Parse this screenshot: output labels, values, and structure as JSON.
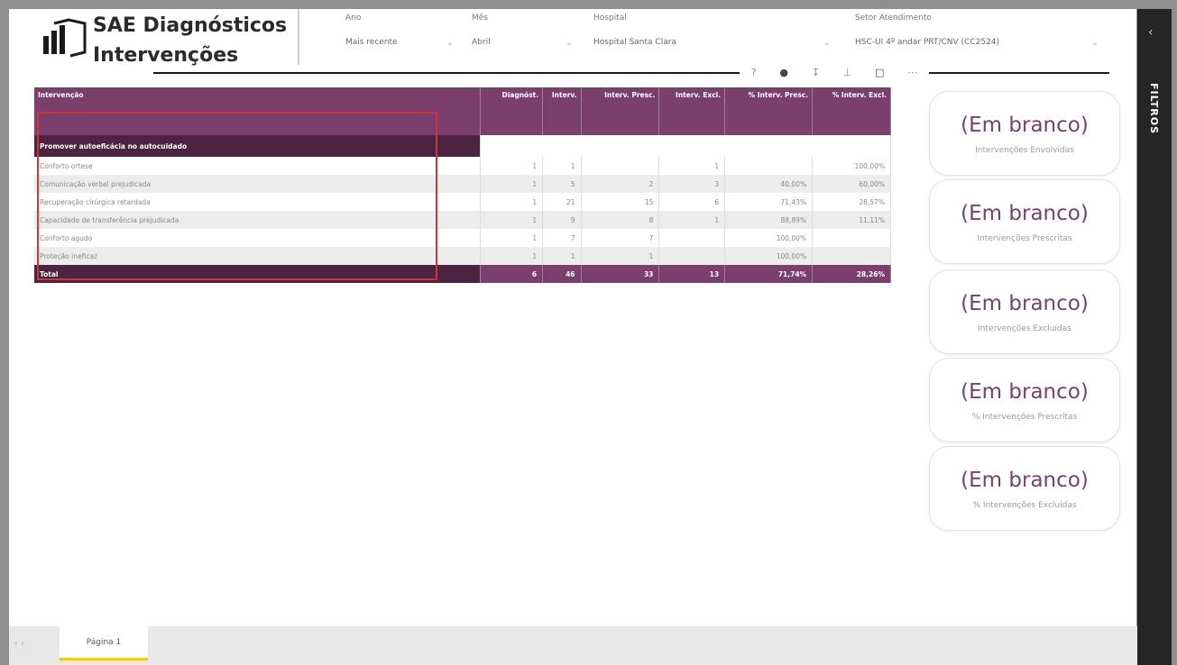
{
  "header": {
    "title_line1": "SAE Diagnósticos",
    "title_line2": "Intervenções"
  },
  "filters": [
    {
      "label": "Ano",
      "value": "Mais recente"
    },
    {
      "label": "Mês",
      "value": "Abril"
    },
    {
      "label": "Hospital",
      "value": "Hospital Santa Clara"
    },
    {
      "label": "Setor Atendimento",
      "value": "HSC-UI 4º andar PRT/CNV (CC2524)"
    }
  ],
  "table": {
    "columns": [
      "Intervenção",
      "Diagnóst.",
      "Interv.",
      "Interv. Presc.",
      "Interv. Excl.",
      "% Interv. Presc.",
      "% Interv. Excl."
    ],
    "group_label": "Promover autoeficácia no autocuidado",
    "rows": [
      {
        "label": "Conforto ortese",
        "c1": "1",
        "c2": "1",
        "c3": "",
        "c4": "1",
        "c5": "",
        "c6": "100,00%"
      },
      {
        "label": "Comunicação verbal prejudicada",
        "c1": "1",
        "c2": "5",
        "c3": "2",
        "c4": "3",
        "c5": "40,00%",
        "c6": "60,00%"
      },
      {
        "label": "Recuperação cirúrgica retardada",
        "c1": "1",
        "c2": "21",
        "c3": "15",
        "c4": "6",
        "c5": "71,43%",
        "c6": "28,57%"
      },
      {
        "label": "Capacidade de transferência prejudicada",
        "c1": "1",
        "c2": "9",
        "c3": "8",
        "c4": "1",
        "c5": "88,89%",
        "c6": "11,11%"
      },
      {
        "label": "Conforto agudo",
        "c1": "1",
        "c2": "7",
        "c3": "7",
        "c4": "",
        "c5": "100,00%",
        "c6": ""
      },
      {
        "label": "Proteção ineficaz",
        "c1": "1",
        "c2": "1",
        "c3": "1",
        "c4": "",
        "c5": "100,00%",
        "c6": ""
      }
    ],
    "total": {
      "label": "Total",
      "c1": "6",
      "c2": "46",
      "c3": "33",
      "c4": "13",
      "c5": "71,74%",
      "c6": "28,26%"
    }
  },
  "cards": [
    {
      "value": "(Em branco)",
      "label": "Intervenções Envolvidas"
    },
    {
      "value": "(Em branco)",
      "label": "Intervenções Prescritas"
    },
    {
      "value": "(Em branco)",
      "label": "Intervenções Excluídas"
    },
    {
      "value": "(Em branco)",
      "label": "% Intervenções Prescritas"
    },
    {
      "value": "(Em branco)",
      "label": "% Intervenções Excluídas"
    }
  ],
  "right_panel": {
    "label": "FILTROS"
  },
  "footer": {
    "page_tab": "Página 1"
  },
  "colors": {
    "accent": "#7a3f6c",
    "accent_dark": "#4c2442",
    "highlight": "#d0343a",
    "tab_underline": "#f2c811"
  }
}
